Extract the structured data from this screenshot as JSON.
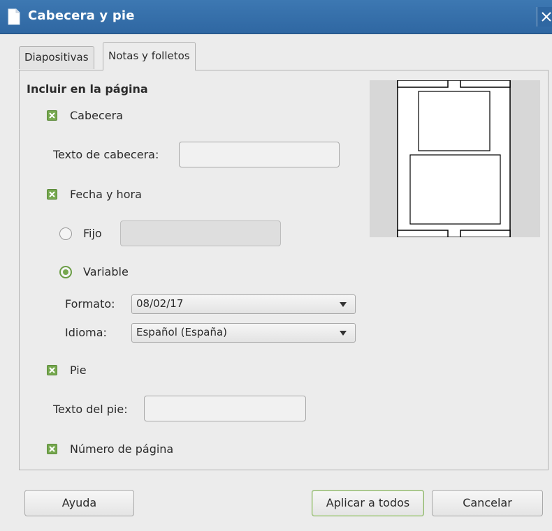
{
  "window": {
    "title": "Cabecera y pie",
    "icon": "document-icon",
    "close_icon": "close-icon"
  },
  "tabs": [
    {
      "label": "Diapositivas",
      "active": false
    },
    {
      "label": "Notas y folletos",
      "active": true
    }
  ],
  "include_section": {
    "label": "Incluir en la página",
    "header": {
      "label": "Cabecera",
      "checked": true,
      "text_label": "Texto de cabecera:",
      "text_value": ""
    },
    "date_time": {
      "label": "Fecha y hora",
      "checked": true,
      "fixed": {
        "label": "Fijo",
        "selected": false,
        "value": ""
      },
      "variable": {
        "label": "Variable",
        "selected": true
      },
      "format": {
        "label": "Formato:",
        "value": "08/02/17"
      },
      "language": {
        "label": "Idioma:",
        "value": "Español (España)"
      }
    },
    "footer": {
      "label": "Pie",
      "checked": true,
      "text_label": "Texto del pie:",
      "text_value": ""
    },
    "page_number": {
      "label": "Número de página",
      "checked": true
    }
  },
  "buttons": {
    "help": "Ayuda",
    "apply_all": "Aplicar a todos",
    "cancel": "Cancelar"
  },
  "colors": {
    "titlebar": "#2f67a2",
    "checkbox": "#76a84f",
    "dialog_bg": "#ececec"
  }
}
